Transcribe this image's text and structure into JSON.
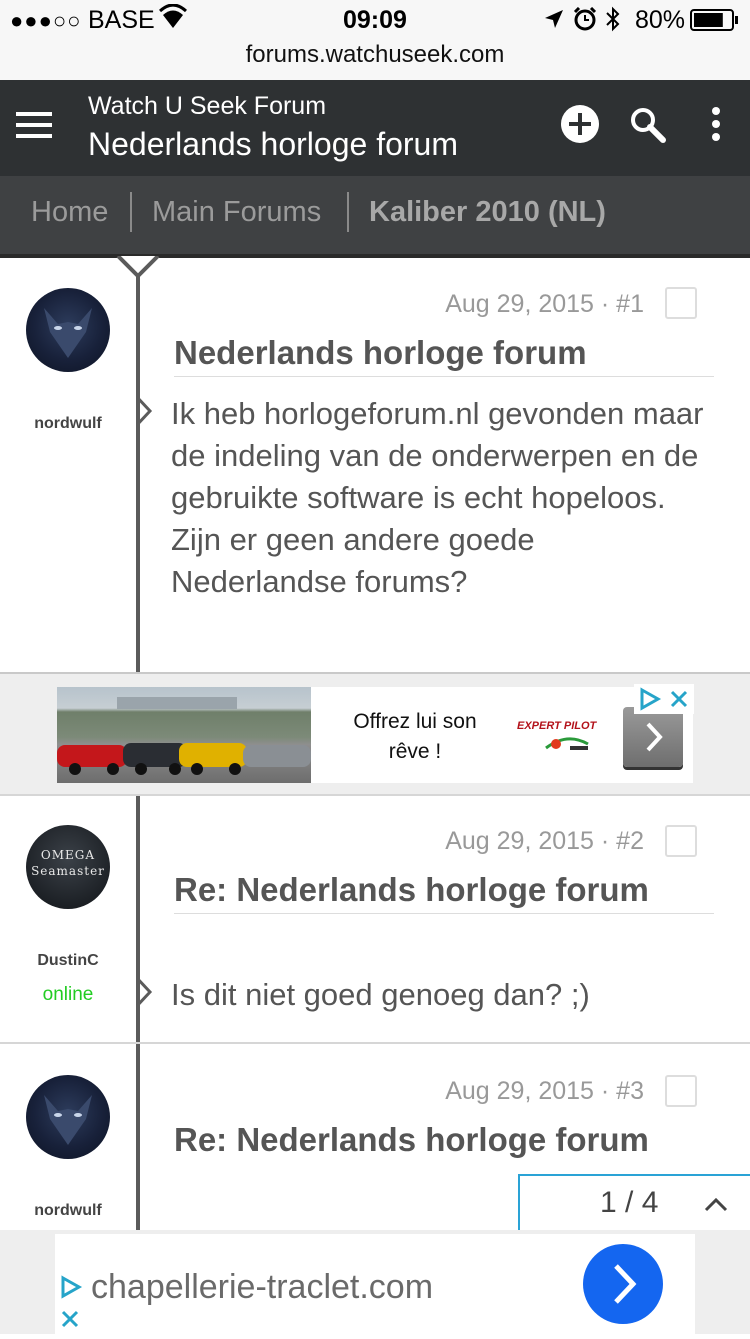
{
  "status_bar": {
    "carrier": "BASE",
    "time": "09:09",
    "battery": "80%",
    "battery_level": 0.8
  },
  "browser": {
    "url": "forums.watchuseek.com"
  },
  "header": {
    "site_title": "Watch U Seek Forum",
    "forum_title": "Nederlands horloge forum"
  },
  "breadcrumb": [
    "Home",
    "Main Forums",
    "Kaliber 2010 (NL)"
  ],
  "posts": [
    {
      "author": "nordwulf",
      "meta": "Aug 29, 2015 · #1",
      "title": "Nederlands horloge forum",
      "body": "Ik heb horlogeforum.nl gevonden maar de indeling van de onderwerpen en de gebruikte software is echt hopeloos. Zijn er geen andere goede Nederlandse forums?"
    },
    {
      "author": "DustinC",
      "status": "online",
      "meta": "Aug 29, 2015 · #2",
      "title": "Re: Nederlands horloge forum",
      "body": "Is dit niet goed genoeg dan? ;)"
    },
    {
      "author": "nordwulf",
      "meta": "Aug 29, 2015 · #3",
      "title": "Re: Nederlands horloge forum"
    }
  ],
  "ad_banner": {
    "text": "Offrez lui son rêve !",
    "brand": "EXPERT PILOT"
  },
  "ad_avatar_text": "OMEGA Seamaster",
  "pagination": {
    "label": "1 / 4"
  },
  "bottom_ad": {
    "domain": "chapellerie-traclet.com"
  },
  "colors": {
    "header": "#2e3133",
    "breadcrumb": "#3f4143",
    "online": "#22cc22",
    "ad_button": "#1466f0"
  }
}
